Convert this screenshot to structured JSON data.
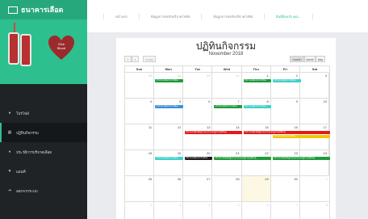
{
  "brand": {
    "title": "ธนาคารเลือด"
  },
  "hero": {
    "heart_line1": "Give",
    "heart_line2": "Blood"
  },
  "menu": [
    {
      "label": "โปรไฟล์",
      "icon": "user-icon"
    },
    {
      "label": "ปฏิทินกิจกรรม",
      "icon": "calendar-icon",
      "active": true
    },
    {
      "label": "ประวัติการบริจาคเลือด",
      "icon": "history-icon"
    },
    {
      "label": "แผนที่",
      "icon": "map-marker-icon"
    },
    {
      "label": "ออกจากระบบ",
      "icon": "logout-icon"
    }
  ],
  "nav": [
    {
      "label": "หน้าแรก"
    },
    {
      "label": "ข้อมูลการขอรับบริจาคโลหิต"
    },
    {
      "label": "ข้อมูลการขอรับบริจาคโลหิต"
    },
    {
      "label": "ยินดีต้อนรับ คุณ...",
      "active": true
    }
  ],
  "calendar": {
    "title": "ปฏิทินกิจกรรม",
    "month": "November 2018",
    "prev": "‹",
    "next": "›",
    "today": "today",
    "views": [
      "month",
      "week",
      "day"
    ],
    "dow": [
      "Sun",
      "Mon",
      "Tue",
      "Wed",
      "Thu",
      "Fri",
      "Sat"
    ],
    "weeks": [
      [
        {
          "d": "28",
          "o": true
        },
        {
          "d": "29",
          "o": true
        },
        {
          "d": "30",
          "o": true
        },
        {
          "d": "31",
          "o": true
        },
        {
          "d": "1"
        },
        {
          "d": "2"
        },
        {
          "d": "3"
        }
      ],
      [
        {
          "d": "4"
        },
        {
          "d": "5"
        },
        {
          "d": "6"
        },
        {
          "d": "7"
        },
        {
          "d": "8"
        },
        {
          "d": "9"
        },
        {
          "d": "10"
        }
      ],
      [
        {
          "d": "11"
        },
        {
          "d": "12"
        },
        {
          "d": "13"
        },
        {
          "d": "14"
        },
        {
          "d": "15"
        },
        {
          "d": "16"
        },
        {
          "d": "17"
        }
      ],
      [
        {
          "d": "18"
        },
        {
          "d": "19"
        },
        {
          "d": "20"
        },
        {
          "d": "21"
        },
        {
          "d": "22"
        },
        {
          "d": "23"
        },
        {
          "d": "24"
        }
      ],
      [
        {
          "d": "25"
        },
        {
          "d": "26"
        },
        {
          "d": "27"
        },
        {
          "d": "28"
        },
        {
          "d": "29",
          "today": true
        },
        {
          "d": "30"
        },
        {
          "d": "1",
          "o": true
        }
      ],
      [
        {
          "d": "2",
          "o": true
        },
        {
          "d": "3",
          "o": true
        },
        {
          "d": "4",
          "o": true
        },
        {
          "d": "5",
          "o": true
        },
        {
          "d": "6",
          "o": true
        },
        {
          "d": "7",
          "o": true
        },
        {
          "d": "8",
          "o": true
        }
      ]
    ],
    "events": [
      {
        "week": 0,
        "col": 1,
        "span": 1,
        "row": 0,
        "title": "บริจาคโลหิตประจำเดือน",
        "color": "#1e9b3a"
      },
      {
        "week": 0,
        "col": 4,
        "span": 1,
        "row": 0,
        "title": "บริจาคโลหิตประจำเดือน",
        "color": "#1e9b3a"
      },
      {
        "week": 0,
        "col": 5,
        "span": 1,
        "row": 0,
        "title": "บริจาคโลหิตประจำเดือน",
        "color": "#3fd0c9"
      },
      {
        "week": 1,
        "col": 1,
        "span": 1,
        "row": 0,
        "title": "บริจาคโลหิตประจำเดือน",
        "color": "#3a8fd9"
      },
      {
        "week": 1,
        "col": 3,
        "span": 1,
        "row": 0,
        "title": "บริจาคโลหิตประจำเดือน",
        "color": "#1e9b3a"
      },
      {
        "week": 1,
        "col": 4,
        "span": 1,
        "row": 0,
        "title": "บริจาคโลหิตประจำเดือน",
        "color": "#3fd0c9"
      },
      {
        "week": 2,
        "col": 2,
        "span": 2,
        "row": 0,
        "title": "บริจาคโลหิตเพื่อผู้ป่วยมะเร็งและผู้ป่วยอุบัติเหตุ",
        "color": "#e21a1a"
      },
      {
        "week": 2,
        "col": 4,
        "span": 3,
        "row": 0,
        "title": "บริจาคโลหิตเพื่อผู้ป่วยมะเร็งและผู้ป่วยอุบัติเหตุ",
        "color": "#e21a1a"
      },
      {
        "week": 2,
        "col": 5,
        "span": 2,
        "row": 1,
        "title": "บริจาคโลหิตประจำเดือน",
        "color": "#f4c500"
      },
      {
        "week": 3,
        "col": 1,
        "span": 1,
        "row": 0,
        "title": "บริจาคโลหิตประจำเดือน",
        "color": "#3fd0c9"
      },
      {
        "week": 3,
        "col": 2,
        "span": 1,
        "row": 0,
        "title": "บริจาคโลหิตประจำเดือน",
        "color": "#1d1d1d"
      },
      {
        "week": 3,
        "col": 3,
        "span": 2,
        "row": 0,
        "title": "บริจาคโลหิตเพื่อผู้ป่วยมะเร็งและผู้ป่วยอุบัติเหตุ",
        "color": "#1e9b3a"
      },
      {
        "week": 3,
        "col": 5,
        "span": 2,
        "row": 0,
        "title": "บริจาคโลหิตเพื่อผู้ป่วยมะเร็งและผู้ป่วยอุบัติเหตุ",
        "color": "#1e9b3a"
      }
    ]
  }
}
